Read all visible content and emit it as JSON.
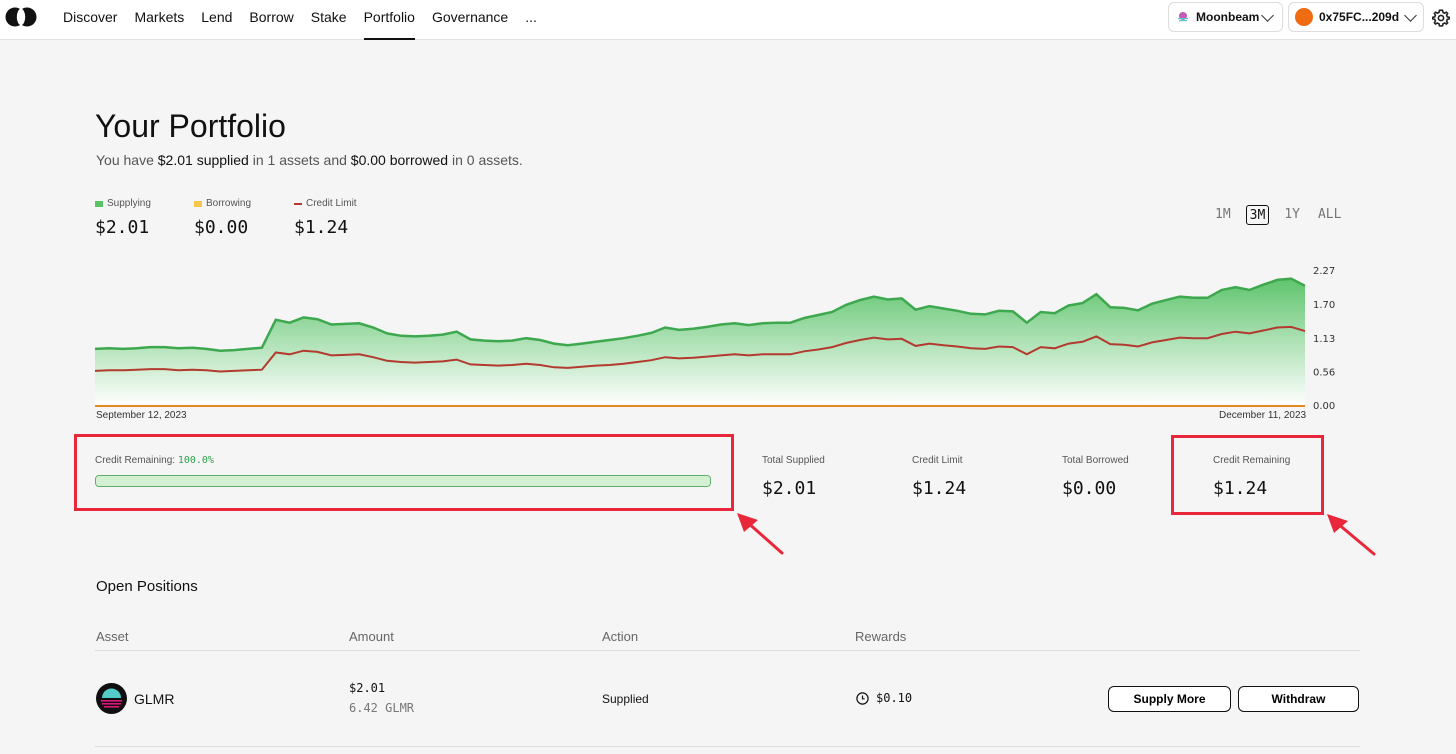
{
  "nav": {
    "items": [
      "Discover",
      "Markets",
      "Lend",
      "Borrow",
      "Stake",
      "Portfolio",
      "Governance"
    ],
    "active": "Portfolio",
    "more": "..."
  },
  "network": {
    "name": "Moonbeam"
  },
  "wallet": {
    "address": "0x75FC...209d"
  },
  "page": {
    "title": "Your Portfolio",
    "summary": {
      "p1": "You have ",
      "supplied": "$2.01 supplied",
      "p2": " in 1 assets and ",
      "borrowed": "$0.00 borrowed",
      "p3": " in 0 assets."
    }
  },
  "legend": [
    {
      "label": "Supplying",
      "value": "$2.01",
      "color": "#5bc267"
    },
    {
      "label": "Borrowing",
      "value": "$0.00",
      "color": "#f3c94b"
    },
    {
      "label": "Credit Limit",
      "value": "$1.24",
      "color": "#b23a2e"
    }
  ],
  "time_range": {
    "options": [
      "1M",
      "3M",
      "1Y",
      "ALL"
    ],
    "active": "3M"
  },
  "chart_data": {
    "type": "area",
    "x_start": "September 12, 2023",
    "x_end": "December 11, 2023",
    "ylim": [
      0,
      2.27
    ],
    "yticks": [
      "2.27",
      "1.70",
      "1.13",
      "0.56",
      "0.00"
    ],
    "series": [
      {
        "name": "Supplying",
        "color": "#3da84e",
        "values": [
          0.96,
          0.97,
          0.96,
          0.97,
          0.99,
          0.99,
          0.97,
          0.98,
          0.96,
          0.93,
          0.94,
          0.96,
          0.98,
          1.45,
          1.4,
          1.49,
          1.46,
          1.37,
          1.38,
          1.39,
          1.32,
          1.22,
          1.18,
          1.17,
          1.18,
          1.2,
          1.25,
          1.12,
          1.1,
          1.09,
          1.1,
          1.14,
          1.11,
          1.05,
          1.02,
          1.05,
          1.08,
          1.11,
          1.14,
          1.18,
          1.23,
          1.32,
          1.28,
          1.3,
          1.33,
          1.37,
          1.39,
          1.36,
          1.39,
          1.4,
          1.4,
          1.48,
          1.53,
          1.58,
          1.7,
          1.78,
          1.84,
          1.79,
          1.81,
          1.62,
          1.68,
          1.64,
          1.6,
          1.55,
          1.54,
          1.6,
          1.59,
          1.4,
          1.58,
          1.56,
          1.69,
          1.73,
          1.88,
          1.66,
          1.65,
          1.61,
          1.72,
          1.78,
          1.84,
          1.82,
          1.82,
          1.95,
          2.0,
          1.95,
          2.04,
          2.12,
          2.14,
          2.02
        ]
      },
      {
        "name": "Credit Limit",
        "color": "#b23a2e",
        "values": [
          0.59,
          0.6,
          0.6,
          0.61,
          0.62,
          0.62,
          0.6,
          0.61,
          0.6,
          0.58,
          0.59,
          0.6,
          0.61,
          0.9,
          0.87,
          0.93,
          0.91,
          0.85,
          0.86,
          0.87,
          0.82,
          0.76,
          0.74,
          0.73,
          0.74,
          0.75,
          0.78,
          0.7,
          0.69,
          0.68,
          0.69,
          0.71,
          0.69,
          0.65,
          0.64,
          0.66,
          0.68,
          0.69,
          0.71,
          0.74,
          0.77,
          0.82,
          0.8,
          0.81,
          0.83,
          0.85,
          0.87,
          0.85,
          0.87,
          0.87,
          0.87,
          0.92,
          0.95,
          0.99,
          1.06,
          1.11,
          1.15,
          1.12,
          1.13,
          1.01,
          1.05,
          1.02,
          1.0,
          0.97,
          0.96,
          1.0,
          0.99,
          0.87,
          0.99,
          0.97,
          1.05,
          1.08,
          1.17,
          1.04,
          1.03,
          1.0,
          1.07,
          1.11,
          1.15,
          1.14,
          1.14,
          1.21,
          1.25,
          1.22,
          1.27,
          1.32,
          1.33,
          1.26
        ]
      },
      {
        "name": "Borrowing",
        "color": "#e58a1f",
        "values": [
          0.0,
          0.0
        ]
      }
    ]
  },
  "credit": {
    "label": "Credit Remaining: ",
    "percent": "100.0%",
    "fraction": 1.0
  },
  "stats": [
    {
      "label": "Total Supplied",
      "value": "$2.01"
    },
    {
      "label": "Credit Limit",
      "value": "$1.24"
    },
    {
      "label": "Total Borrowed",
      "value": "$0.00"
    },
    {
      "label": "Credit Remaining",
      "value": "$1.24"
    }
  ],
  "positions": {
    "title": "Open Positions",
    "headers": [
      "Asset",
      "Amount",
      "Action",
      "Rewards"
    ],
    "rows": [
      {
        "asset": "GLMR",
        "amount_usd": "$2.01",
        "amount_token": "6.42 GLMR",
        "action": "Supplied",
        "rewards": "$0.10",
        "buttons": [
          "Supply More",
          "Withdraw"
        ]
      }
    ]
  }
}
